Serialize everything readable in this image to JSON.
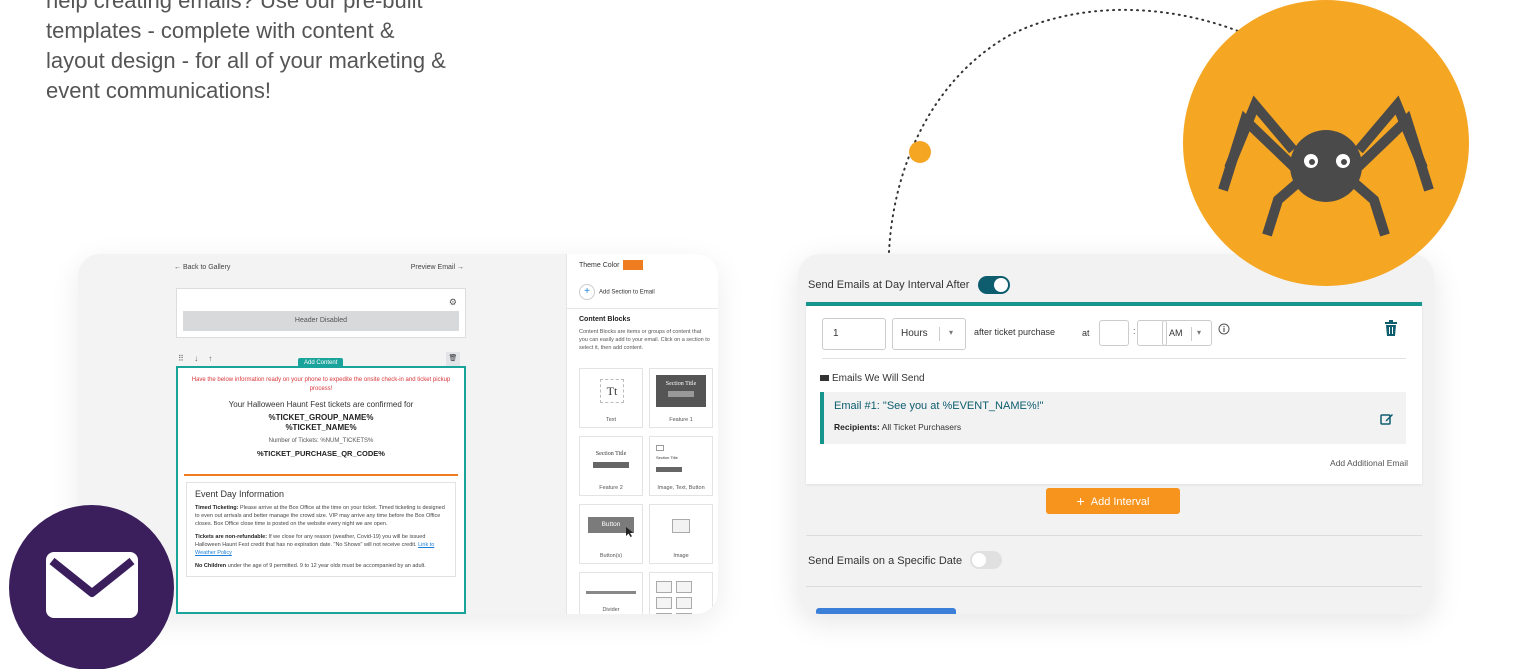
{
  "intro": {
    "lines": [
      "help creating emails? Use our pre-built",
      "templates - complete with content &",
      "layout design - for all of your marketing &",
      "event communications!"
    ]
  },
  "colors": {
    "spider_circle": "#f5a623",
    "mail_circle": "#3b1f5c",
    "teal": "#16948e",
    "dark_teal": "#0d5d6e",
    "orange": "#f7941d",
    "red_text": "#d9373c"
  },
  "icons": [
    "spider-icon",
    "envelope-icon",
    "gear-icon",
    "trash-icon",
    "edit-icon",
    "info-icon",
    "image-icon",
    "cursor-icon"
  ],
  "editor": {
    "back_label": "← Back to Gallery",
    "preview_label": "Preview Email →",
    "header_disabled": "Header Disabled",
    "add_content": "Add Content",
    "tools": "⠿ ↓ ↑",
    "red_notice": "Have the below information ready on your phone to expedite the onsite check-in and ticket pickup process!",
    "confirmed": "Your Halloween Haunt Fest tickets are confirmed for",
    "group_name": "%TICKET_GROUP_NAME%",
    "ticket_name": "%TICKET_NAME%",
    "num_tickets": "Number of Tickets: %NUM_TICKETS%",
    "qr_code": "%TICKET_PURCHASE_QR_CODE%",
    "event_info_title": "Event Day Information",
    "timed_label": "Timed Ticketing:",
    "timed_text": "Please arrive at the Box Office at the time on your ticket. Timed ticketing is designed to even out arrivals and better manage the crowd size. VIP may arrive any time before the Box Office closes. Box Office close time is posted on the website every night we are open.",
    "nonref_label": "Tickets are non-refundable:",
    "nonref_text": "If we close for any reason (weather, Covid-19) you will be issued Halloween Haunt Fest credit that has no expiration date. \"No Shows\" will not receive credit.",
    "weather_link": "Link to Weather Policy",
    "children_label": "No Children",
    "children_text": "under the age of 9 permitted. 9 to 12 year olds must be accompanied by an adult."
  },
  "sidebar": {
    "theme_color_label": "Theme Color",
    "add_section_label": "Add Section to Email",
    "content_blocks_title": "Content Blocks",
    "content_blocks_desc": "Content Blocks are items or groups of content that you can easily add to your email. Click on a section to select it, then add content.",
    "blocks": {
      "text": {
        "icon_text": "Tt",
        "label": "Text"
      },
      "feature1": {
        "title": "Section Title",
        "button": "Learn More",
        "label": "Feature 1"
      },
      "feature2": {
        "title": "Section Title",
        "button": "Learn More",
        "label": "Feature 2"
      },
      "image_text_button": {
        "title": "Section Title",
        "button": "Learn More",
        "label": "Image, Text, Button"
      },
      "buttons": {
        "button_text": "Button",
        "label": "Button(s)"
      },
      "image": {
        "label": "Image"
      },
      "divider": {
        "label": "Divider"
      }
    }
  },
  "interval_settings": {
    "day_interval_label": "Send Emails at Day Interval After",
    "day_interval_on": true,
    "amount_value": "1",
    "unit_value": "Hours",
    "after_label": "after ticket purchase",
    "at_label": "at",
    "ampm_value": "AM",
    "emails_we_send_label": "Emails We Will Send",
    "email_item": {
      "title": "Email #1: \"See you at %EVENT_NAME%!\"",
      "recipients_label": "Recipients:",
      "recipients_value": "All Ticket Purchasers"
    },
    "add_additional_email": "Add Additional Email",
    "add_interval_label": "Add Interval",
    "specific_date_label": "Send Emails on a Specific Date",
    "specific_date_on": false
  }
}
